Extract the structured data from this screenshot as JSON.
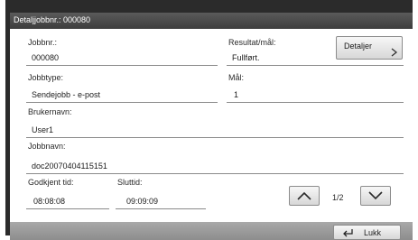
{
  "window": {
    "title": "Detaljjobbnr.: 000080"
  },
  "fields": {
    "job_number": {
      "label": "Jobbnr.:",
      "value": "000080"
    },
    "result_target": {
      "label": "Resultat/mål:",
      "value": "Fullført."
    },
    "job_type": {
      "label": "Jobbtype:",
      "value": "Sendejobb - e-post"
    },
    "target": {
      "label": "Mål:",
      "value": "1"
    },
    "username": {
      "label": "Brukernavn:",
      "value": "User1"
    },
    "job_name": {
      "label": "Jobbnavn:",
      "value": "doc20070404115151"
    },
    "accepted_time": {
      "label": "Godkjent tid:",
      "value": "08:08:08"
    },
    "end_time": {
      "label": "Sluttid:",
      "value": "09:09:09"
    }
  },
  "buttons": {
    "details": "Detaljer",
    "close": "Lukk"
  },
  "pager": {
    "page": "1/2"
  },
  "icons": {
    "details": "chevron-right-icon",
    "up": "chevron-up-icon",
    "down": "chevron-down-icon",
    "close": "return-arrow-icon"
  }
}
